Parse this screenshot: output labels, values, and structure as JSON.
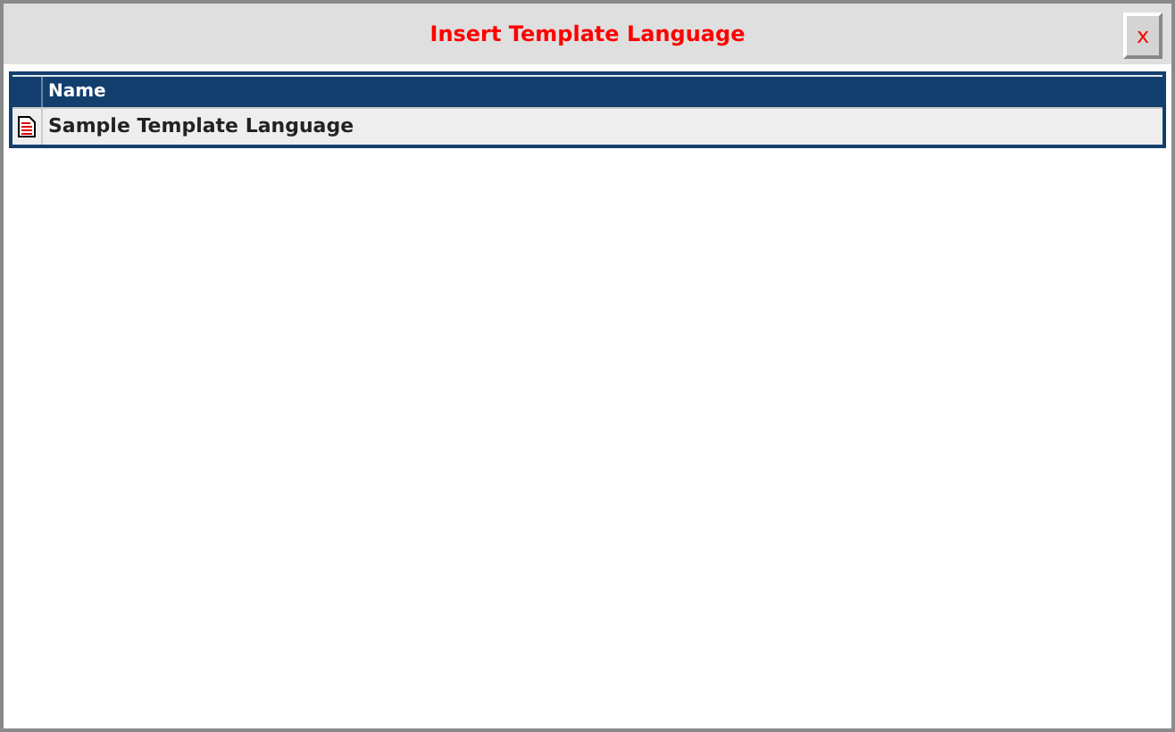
{
  "window": {
    "title": "Insert Template Language",
    "close": "x"
  },
  "table": {
    "columns": [
      "Name"
    ],
    "rows": [
      {
        "name": "Sample Template Language",
        "selected": false
      }
    ]
  }
}
